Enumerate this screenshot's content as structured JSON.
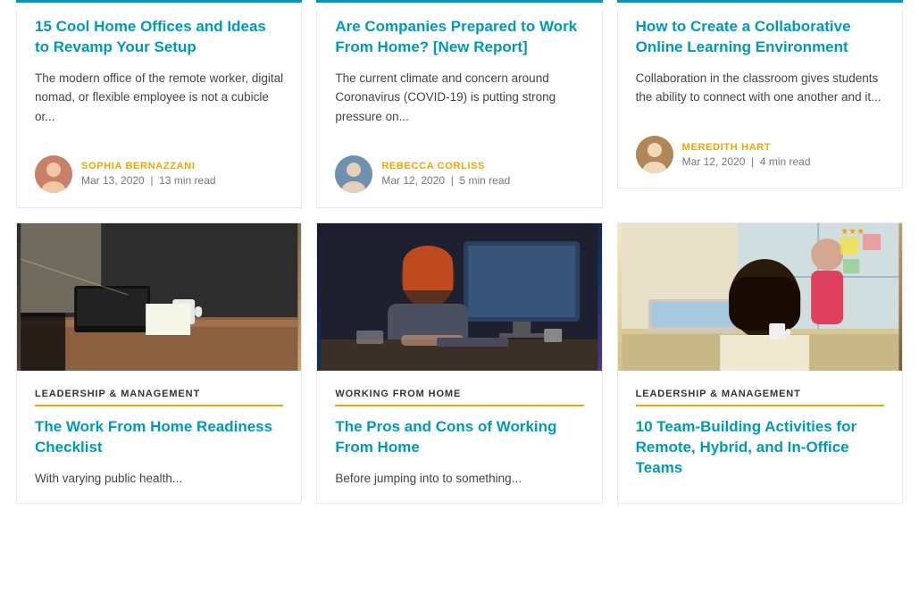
{
  "cards_top": [
    {
      "id": "card-top-1",
      "title": "15 Cool Home Offices and Ideas to Revamp Your Setup",
      "excerpt": "The modern office of the remote worker, digital nomad, or flexible employee is not a cubicle or...",
      "author_name": "SOPHIA BERNAZZANI",
      "author_date": "Mar 13, 2020",
      "author_meta": "13 min read",
      "avatar_class": "avatar-sophia"
    },
    {
      "id": "card-top-2",
      "title": "Are Companies Prepared to Work From Home? [New Report]",
      "excerpt": "The current climate and concern around Coronavirus (COVID-19) is putting strong pressure on...",
      "author_name": "REBECCA CORLISS",
      "author_date": "Mar 12, 2020",
      "author_meta": "5 min read",
      "avatar_class": "avatar-rebecca"
    },
    {
      "id": "card-top-3",
      "title": "How to Create a Collaborative Online Learning Environment",
      "excerpt": "Collaboration in the classroom gives students the ability to connect with one another and it...",
      "author_name": "MEREDITH HART",
      "author_date": "Mar 12, 2020",
      "author_meta": "4 min read",
      "avatar_class": "avatar-meredith"
    }
  ],
  "cards_bottom": [
    {
      "id": "card-bot-1",
      "category": "LEADERSHIP & MANAGEMENT",
      "title": "The Work From Home Readiness Checklist",
      "excerpt": "With varying public health...",
      "img_class": "img-desk"
    },
    {
      "id": "card-bot-2",
      "category": "WORKING FROM HOME",
      "title": "The Pros and Cons of Working From Home",
      "excerpt": "Before jumping into to something...",
      "img_class": "img-computer"
    },
    {
      "id": "card-bot-3",
      "category": "LEADERSHIP & MANAGEMENT",
      "title": "10 Team-Building Activities for Remote, Hybrid, and In-Office Teams",
      "excerpt": "",
      "img_class": "img-office"
    }
  ],
  "separator": "|"
}
